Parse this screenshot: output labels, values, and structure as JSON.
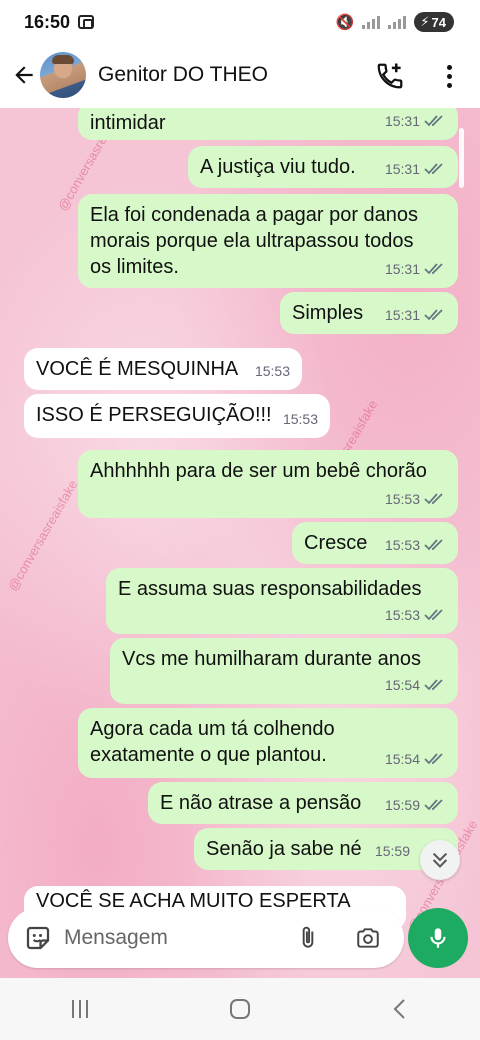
{
  "status_bar": {
    "time": "16:50",
    "battery": "74"
  },
  "header": {
    "contact_name": "Genitor DO THEO"
  },
  "messages": [
    {
      "text": "intimidar",
      "time": "15:31",
      "direction": "out"
    },
    {
      "text": "A justiça viu tudo.",
      "time": "15:31",
      "direction": "out"
    },
    {
      "text": "Ela foi condenada a pagar por danos\nmorais porque ela ultrapassou todos\nos limites.",
      "time": "15:31",
      "direction": "out"
    },
    {
      "text": "Simples",
      "time": "15:31",
      "direction": "out"
    },
    {
      "text": "VOCÊ É MESQUINHA",
      "time": "15:53",
      "direction": "in"
    },
    {
      "text": "ISSO É PERSEGUIÇÃO!!!",
      "time": "15:53",
      "direction": "in"
    },
    {
      "text": "Ahhhhhh para de ser um bebê chorão",
      "time": "15:53",
      "direction": "out"
    },
    {
      "text": "Cresce",
      "time": "15:53",
      "direction": "out"
    },
    {
      "text": "E assuma suas responsabilidades",
      "time": "15:53",
      "direction": "out"
    },
    {
      "text": "Vcs me humilharam durante anos",
      "time": "15:54",
      "direction": "out"
    },
    {
      "text": "Agora cada um tá colhendo\nexatamente o que plantou.",
      "time": "15:54",
      "direction": "out"
    },
    {
      "text": "E não atrase a pensão",
      "time": "15:59",
      "direction": "out"
    },
    {
      "text": "Senão ja sabe né",
      "time": "15:59",
      "direction": "out"
    },
    {
      "text": "VOCÊ SE ACHA MUITO ESPERTA",
      "time": "",
      "direction": "in"
    }
  ],
  "watermark": "@conversasreaisfake",
  "composer": {
    "placeholder": "Mensagem"
  },
  "colors": {
    "outgoing_bubble": "#d7f9c9",
    "incoming_bubble": "#ffffff",
    "accent": "#1daa61",
    "read_ticks": "#667781"
  }
}
